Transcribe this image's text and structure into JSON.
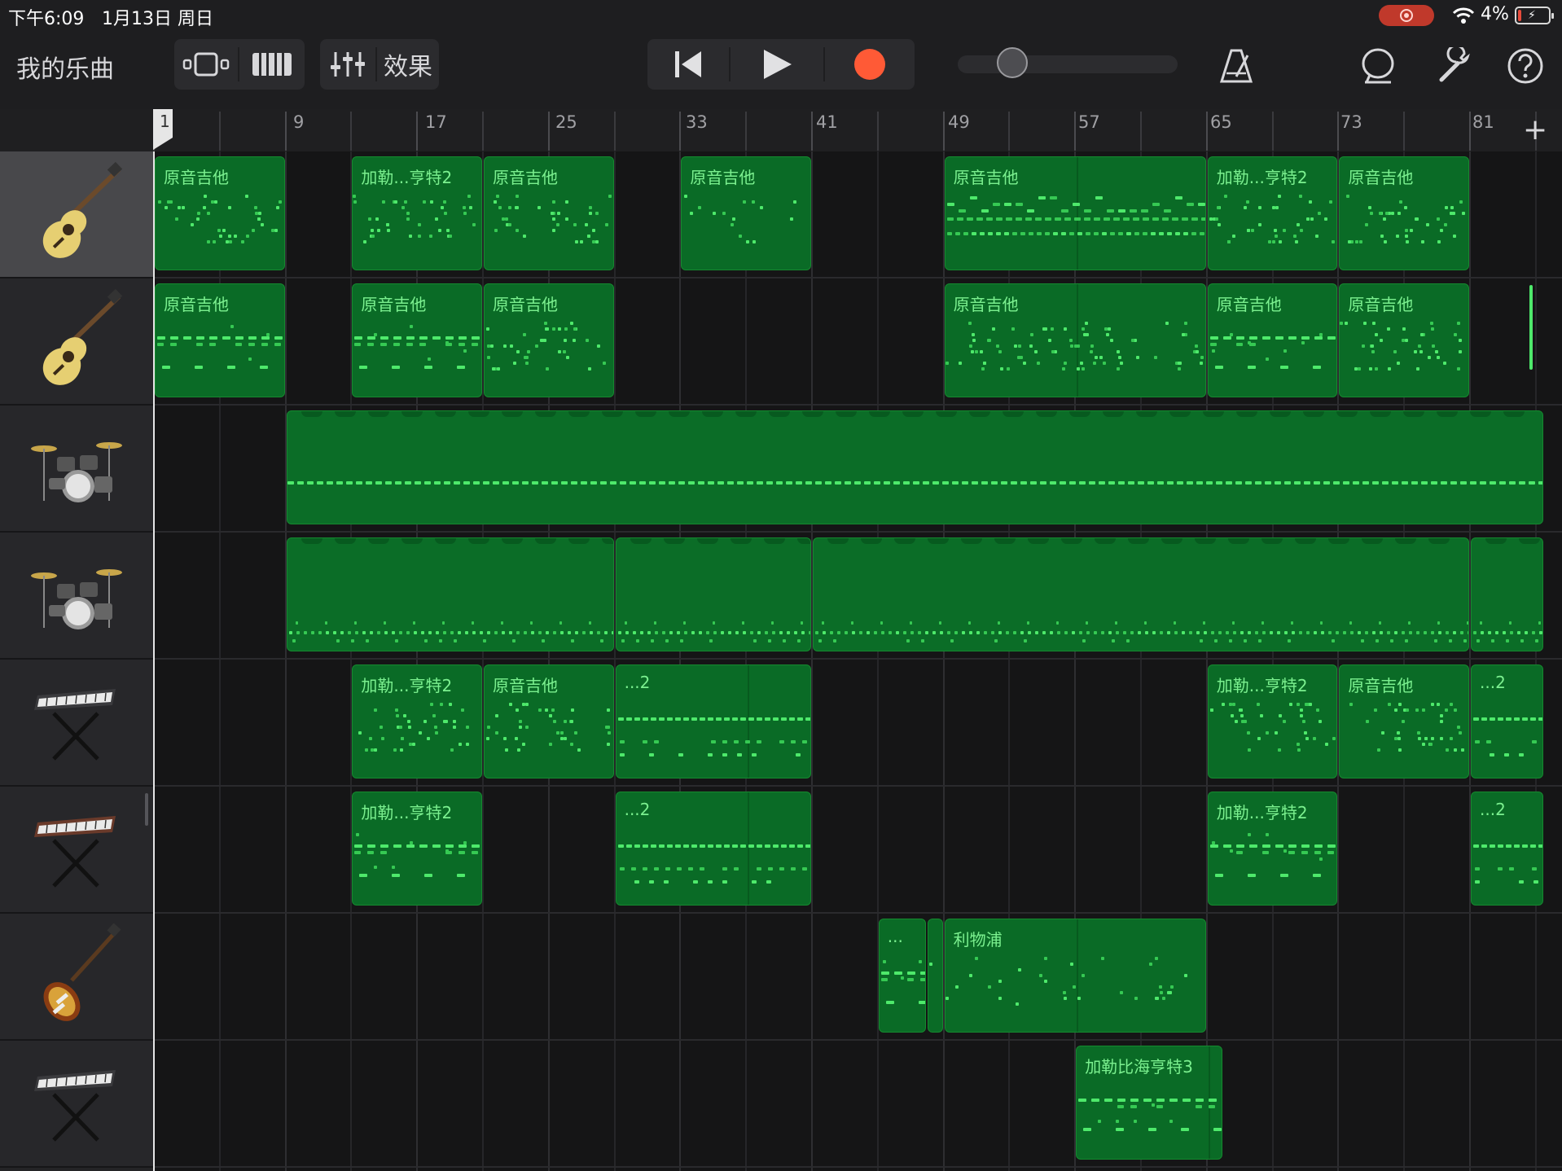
{
  "status_bar": {
    "time": "下午6:09",
    "date": "1月13日 周日",
    "battery_pct": "4%"
  },
  "toolbar": {
    "my_songs": "我的乐曲",
    "fx_label": "效果",
    "icons": [
      "browser-icon",
      "keyboard-icon",
      "mixer-icon",
      "go-to-start-icon",
      "play-icon",
      "record-icon",
      "metronome-icon",
      "loop-icon",
      "settings-wrench-icon",
      "help-icon"
    ],
    "accent_record": "#ff5a36"
  },
  "ruler": {
    "playhead_bar": "1",
    "bars": [
      "9",
      "17",
      "25",
      "33",
      "41",
      "49",
      "57",
      "65",
      "73",
      "81"
    ],
    "add_section_icon": "plus-icon"
  },
  "tracks": [
    {
      "name": "acoustic-guitar-1",
      "instrument_icon": "acoustic-guitar-icon",
      "regions": [
        {
          "label": "原音吉他",
          "start": 1,
          "end": 9,
          "pattern": "scatter"
        },
        {
          "label": "加勒...亨特2",
          "start": 13,
          "end": 21,
          "pattern": "scatter"
        },
        {
          "label": "原音吉他",
          "start": 21,
          "end": 29,
          "pattern": "scatter"
        },
        {
          "label": "原音吉他",
          "start": 33,
          "end": 41,
          "pattern": "sparse"
        },
        {
          "label": "原音吉他",
          "start": 49,
          "end": 65,
          "pattern": "dense"
        },
        {
          "label": "加勒...亨特2",
          "start": 65,
          "end": 73,
          "pattern": "scatter"
        },
        {
          "label": "原音吉他",
          "start": 73,
          "end": 81,
          "pattern": "scatter"
        }
      ]
    },
    {
      "name": "acoustic-guitar-2",
      "instrument_icon": "acoustic-guitar-icon",
      "regions": [
        {
          "label": "原音吉他",
          "start": 1,
          "end": 9,
          "pattern": "chords"
        },
        {
          "label": "原音吉他",
          "start": 13,
          "end": 21,
          "pattern": "chords"
        },
        {
          "label": "原音吉他",
          "start": 21,
          "end": 29,
          "pattern": "scatter"
        },
        {
          "label": "原音吉他",
          "start": 49,
          "end": 65,
          "pattern": "scatter"
        },
        {
          "label": "原音吉他",
          "start": 65,
          "end": 73,
          "pattern": "chords"
        },
        {
          "label": "原音吉他",
          "start": 73,
          "end": 81,
          "pattern": "scatter"
        }
      ]
    },
    {
      "name": "drums-1",
      "instrument_icon": "drum-kit-icon",
      "regions": [
        {
          "label": "",
          "start": 9,
          "end": 85.5,
          "pattern": "line"
        }
      ]
    },
    {
      "name": "drums-2",
      "instrument_icon": "drum-kit-icon",
      "regions": [
        {
          "label": "",
          "start": 9,
          "end": 29,
          "pattern": "drumrow"
        },
        {
          "label": "",
          "start": 29,
          "end": 41,
          "pattern": "drumrow"
        },
        {
          "label": "",
          "start": 41,
          "end": 81,
          "pattern": "drumrow"
        },
        {
          "label": "",
          "start": 81,
          "end": 85.5,
          "pattern": "drumrow"
        }
      ]
    },
    {
      "name": "keyboard-1",
      "instrument_icon": "keyboard-stand-icon",
      "regions": [
        {
          "label": "加勒...亨特2",
          "start": 13,
          "end": 21,
          "pattern": "scatter"
        },
        {
          "label": "原音吉他",
          "start": 21,
          "end": 29,
          "pattern": "scatter"
        },
        {
          "label": "...2",
          "start": 29,
          "end": 41,
          "pattern": "lines"
        },
        {
          "label": "加勒...亨特2",
          "start": 65,
          "end": 73,
          "pattern": "scatter"
        },
        {
          "label": "原音吉他",
          "start": 73,
          "end": 81,
          "pattern": "scatter"
        },
        {
          "label": "...2",
          "start": 81,
          "end": 85.5,
          "pattern": "lines"
        }
      ]
    },
    {
      "name": "keyboard-2",
      "instrument_icon": "keyboard-stand-icon",
      "regions": [
        {
          "label": "加勒...亨特2",
          "start": 13,
          "end": 21,
          "pattern": "chords"
        },
        {
          "label": "...2",
          "start": 29,
          "end": 41,
          "pattern": "lines"
        },
        {
          "label": "加勒...亨特2",
          "start": 65,
          "end": 73,
          "pattern": "chords"
        },
        {
          "label": "...2",
          "start": 81,
          "end": 85.5,
          "pattern": "lines"
        }
      ]
    },
    {
      "name": "bass-guitar",
      "instrument_icon": "bass-guitar-icon",
      "regions": [
        {
          "label": "...",
          "start": 45,
          "end": 48,
          "pattern": "chords"
        },
        {
          "label": "",
          "start": 48,
          "end": 49,
          "pattern": "sparse"
        },
        {
          "label": "利物浦",
          "start": 49,
          "end": 65,
          "pattern": "sparse"
        }
      ]
    },
    {
      "name": "keyboard-3",
      "instrument_icon": "keyboard-stand-icon",
      "regions": [
        {
          "label": "加勒比海亨特3",
          "start": 57,
          "end": 66,
          "pattern": "chords"
        }
      ]
    }
  ],
  "colors": {
    "region_fill": "#0a6b26",
    "note_color": "#4ee96b",
    "label_color": "#7bf08f",
    "selected_header": "#48484b"
  }
}
